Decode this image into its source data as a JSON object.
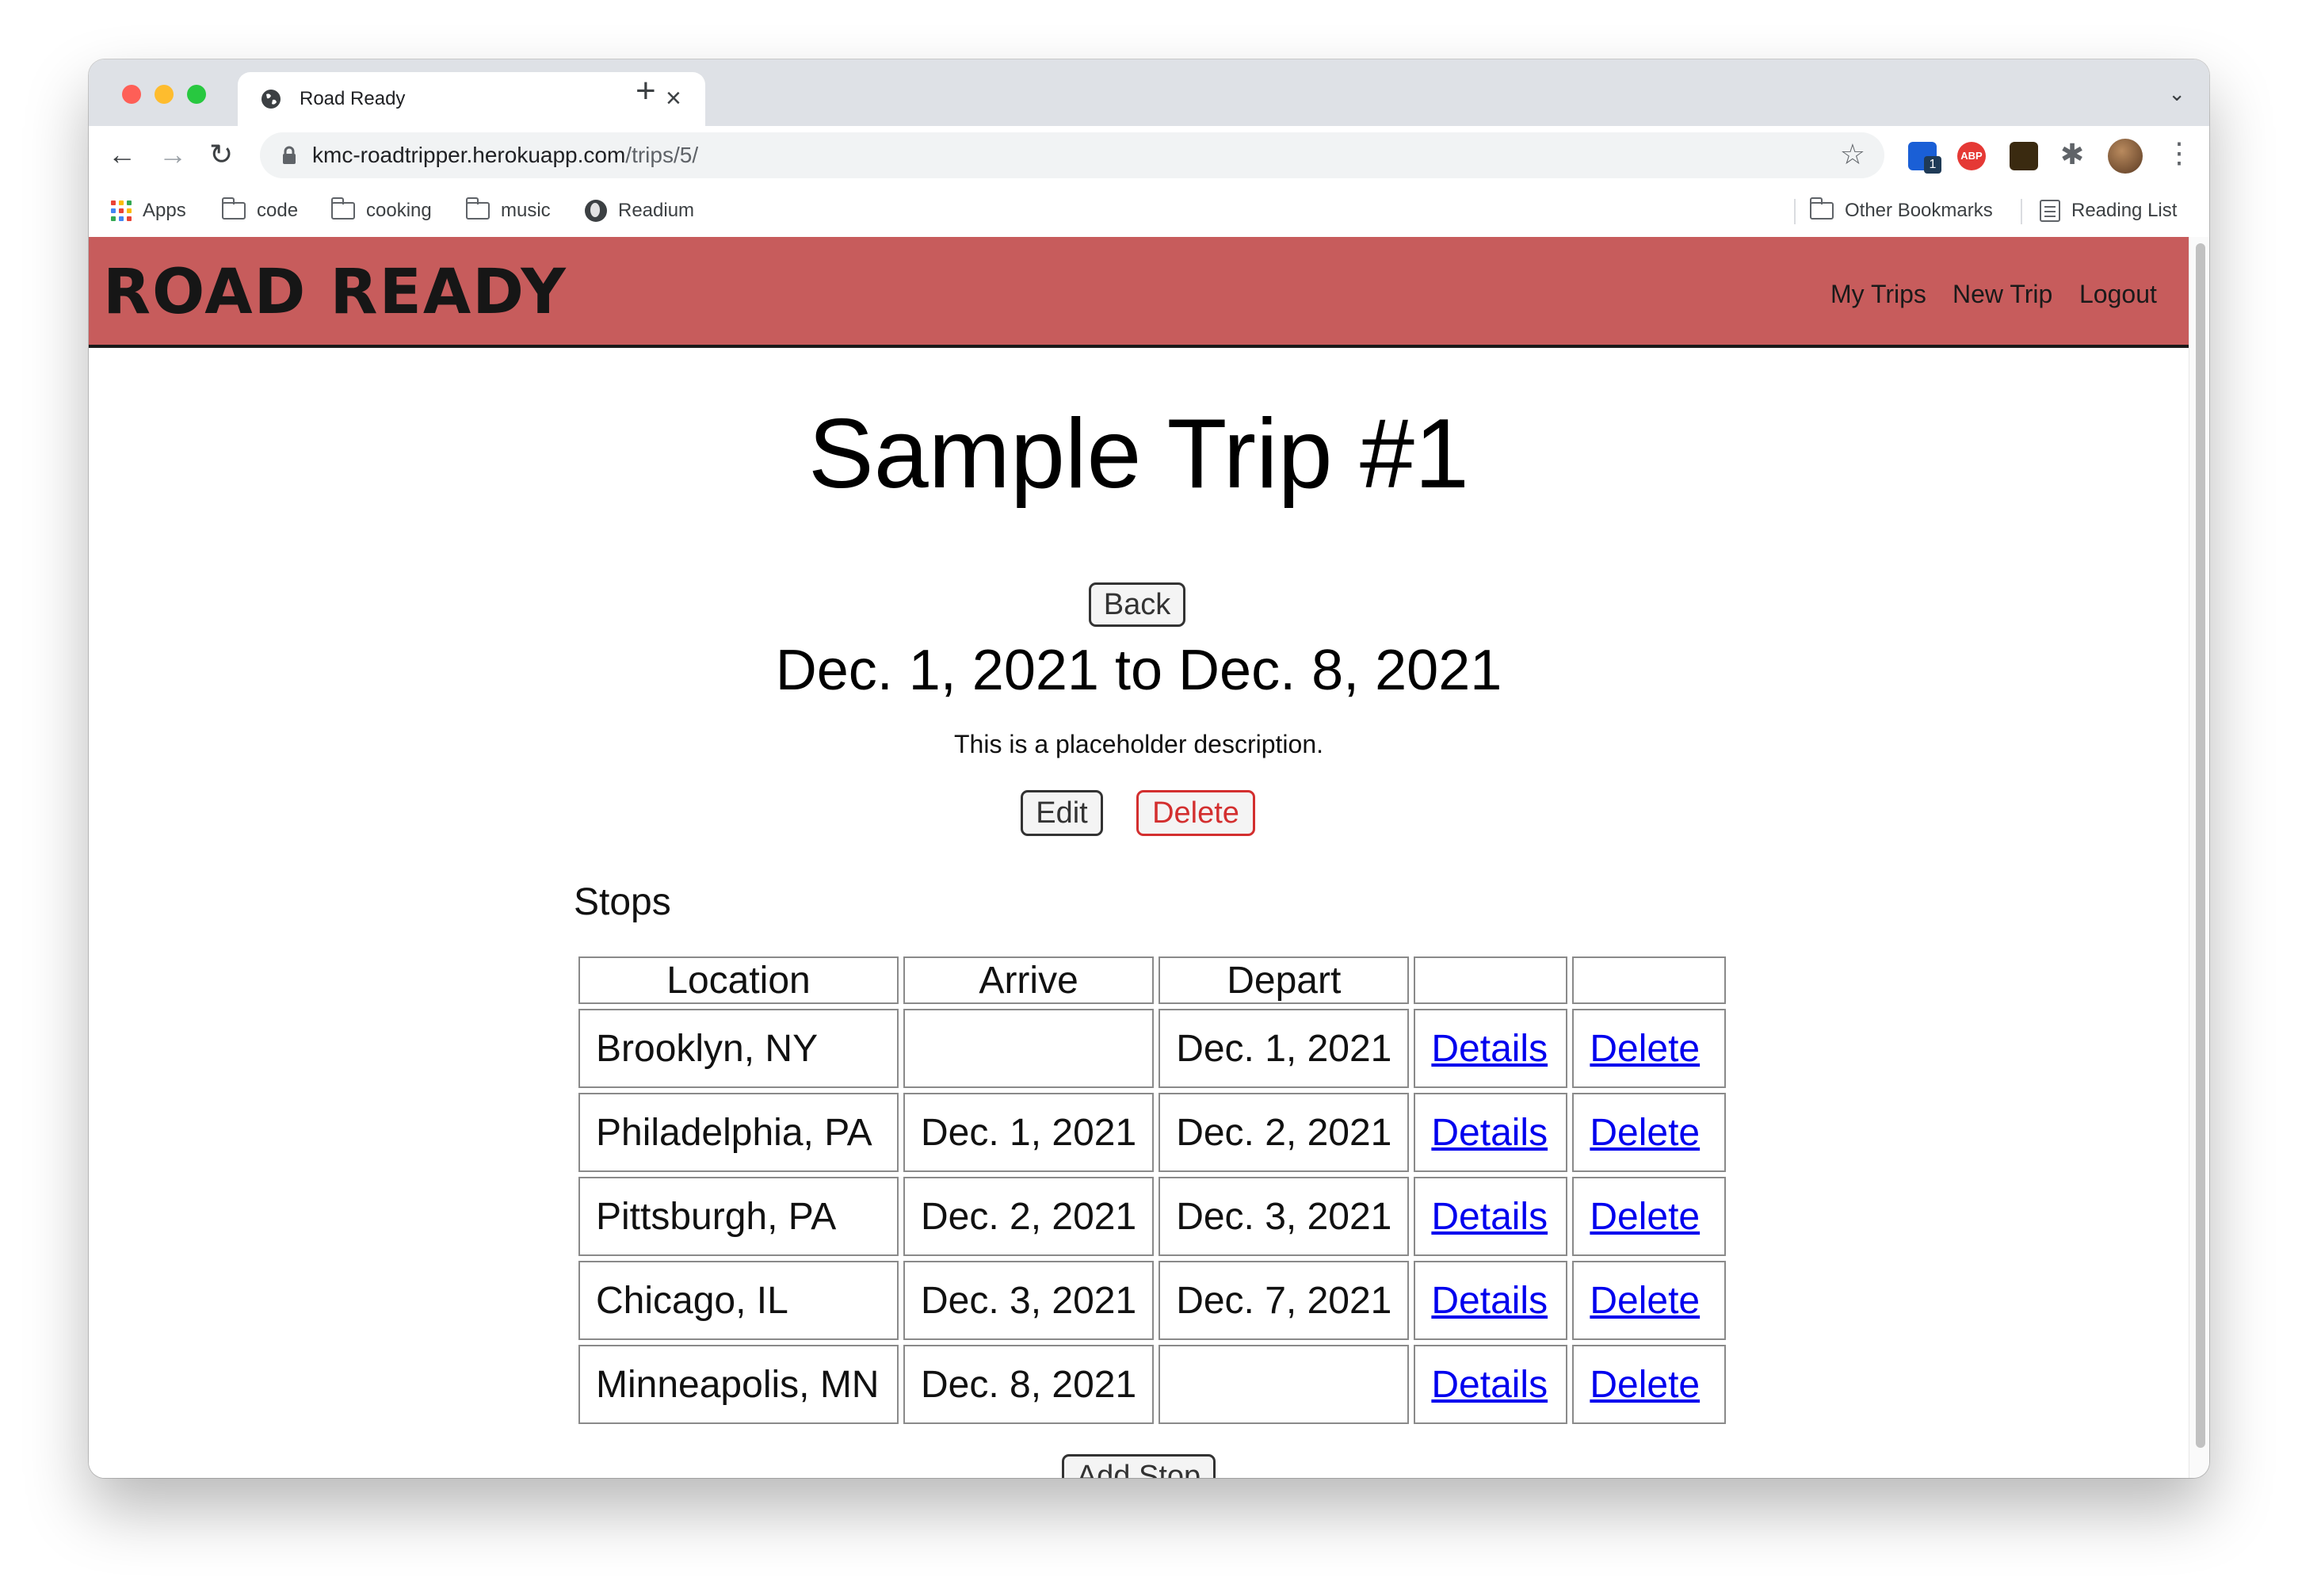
{
  "browser": {
    "tab_title": "Road Ready",
    "url_domain": "kmc-roadtripper.herokuapp.com",
    "url_path": "/trips/5/",
    "bookmarks": [
      "Apps",
      "code",
      "cooking",
      "music",
      "Readium"
    ],
    "other_bookmarks": "Other Bookmarks",
    "reading_list": "Reading List",
    "extension_badge": "1",
    "abp_label": "ABP"
  },
  "site": {
    "brand": "ROAD READY",
    "nav": [
      "My Trips",
      "New Trip",
      "Logout"
    ]
  },
  "trip": {
    "title": "Sample Trip #1",
    "back_label": "Back",
    "dates": "Dec. 1, 2021 to Dec. 8, 2021",
    "description": "This is a placeholder description.",
    "edit_label": "Edit",
    "delete_label": "Delete"
  },
  "stops": {
    "heading": "Stops",
    "columns": [
      "Location",
      "Arrive",
      "Depart",
      "",
      ""
    ],
    "rows": [
      {
        "location": "Brooklyn, NY",
        "arrive": "",
        "depart": "Dec. 1, 2021",
        "details": "Details",
        "delete": "Delete"
      },
      {
        "location": "Philadelphia, PA",
        "arrive": "Dec. 1, 2021",
        "depart": "Dec. 2, 2021",
        "details": "Details",
        "delete": "Delete"
      },
      {
        "location": "Pittsburgh, PA",
        "arrive": "Dec. 2, 2021",
        "depart": "Dec. 3, 2021",
        "details": "Details",
        "delete": "Delete"
      },
      {
        "location": "Chicago, IL",
        "arrive": "Dec. 3, 2021",
        "depart": "Dec. 7, 2021",
        "details": "Details",
        "delete": "Delete"
      },
      {
        "location": "Minneapolis, MN",
        "arrive": "Dec. 8, 2021",
        "depart": "",
        "details": "Details",
        "delete": "Delete"
      }
    ],
    "add_label": "Add Stop"
  },
  "colors": {
    "header_bg": "#c75c5c",
    "link": "#0000ee",
    "danger": "#d32f2f"
  }
}
